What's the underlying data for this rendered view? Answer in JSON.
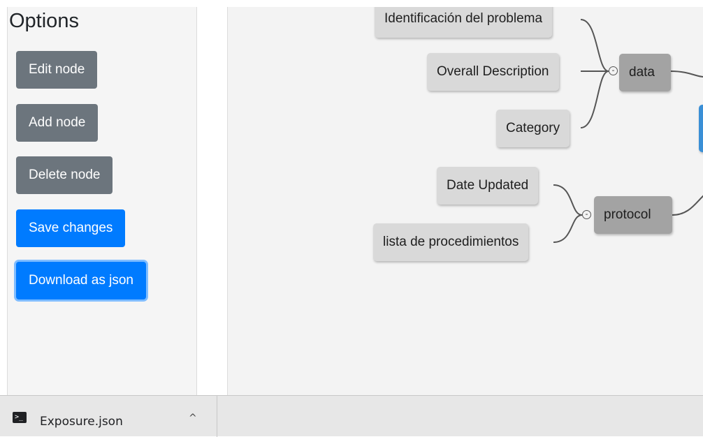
{
  "sidebar": {
    "title": "Options",
    "buttons": {
      "edit": "Edit node",
      "add": "Add node",
      "delete": "Delete node",
      "save": "Save changes",
      "download": "Download as json"
    }
  },
  "mindmap": {
    "groups": {
      "data": {
        "label": "data",
        "children": [
          "Identificación del problema",
          "Overall Description",
          "Category"
        ]
      },
      "protocol": {
        "label": "protocol",
        "children": [
          "Date Updated",
          "lista de procedimientos"
        ]
      }
    },
    "collapse_symbol": "-"
  },
  "download_bar": {
    "file_name": "Exposure.json",
    "icon": "terminal-file-icon",
    "chevron": "^"
  },
  "colors": {
    "primary": "#007bff",
    "secondary": "#6c757d",
    "root_node": "#3a8fd6",
    "group_node": "#a3a3a3",
    "leaf_node": "#d9d9d9"
  }
}
